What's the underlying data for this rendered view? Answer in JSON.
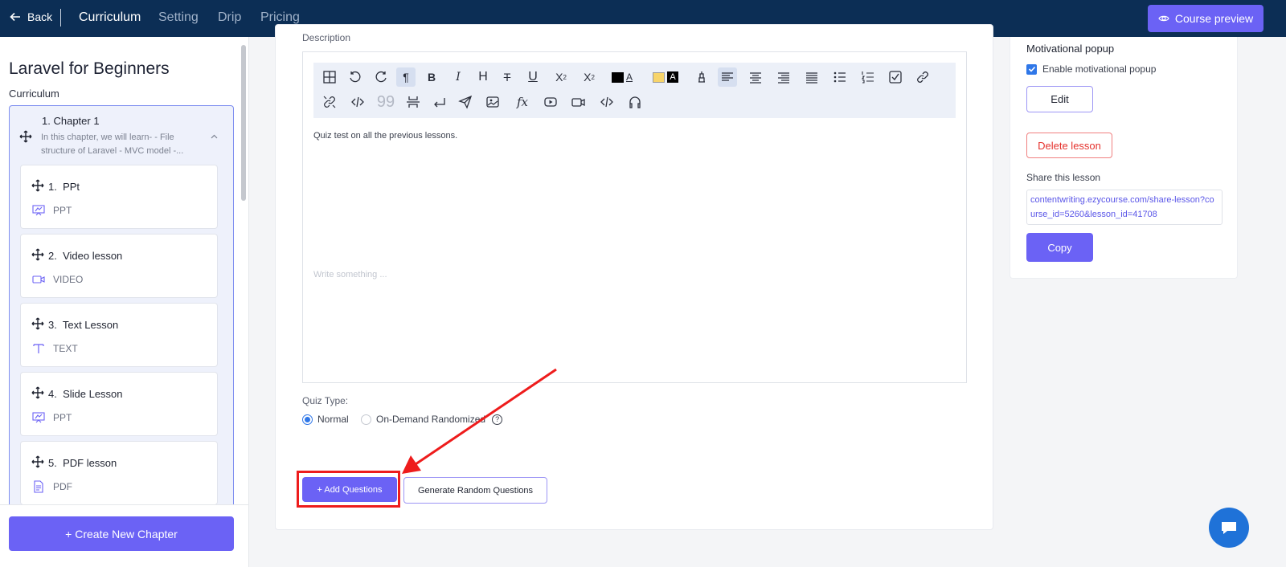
{
  "topbar": {
    "back_label": "Back",
    "tabs": [
      {
        "label": "Curriculum",
        "active": true
      },
      {
        "label": "Setting",
        "active": false
      },
      {
        "label": "Drip",
        "active": false
      },
      {
        "label": "Pricing",
        "active": false
      }
    ],
    "preview_label": "Course preview"
  },
  "sidebar": {
    "course_title": "Laravel for Beginners",
    "curriculum_label": "Curriculum",
    "chapter": {
      "number": "1.",
      "title": "Chapter 1",
      "description": "In this chapter, we will learn- - File structure of Laravel - MVC model -..."
    },
    "lessons": [
      {
        "number": "1.",
        "title": "PPt",
        "type": "PPT",
        "icon": "presentation-icon"
      },
      {
        "number": "2.",
        "title": "Video lesson",
        "type": "VIDEO",
        "icon": "video-icon"
      },
      {
        "number": "3.",
        "title": "Text Lesson",
        "type": "TEXT",
        "icon": "text-icon"
      },
      {
        "number": "4.",
        "title": "Slide Lesson",
        "type": "PPT",
        "icon": "presentation-icon"
      },
      {
        "number": "5.",
        "title": "PDF lesson",
        "type": "PDF",
        "icon": "document-icon"
      }
    ],
    "create_chapter_label": "+ Create New Chapter"
  },
  "editor": {
    "description_label": "Description",
    "content": "Quiz test on all the previous lessons.",
    "placeholder": "Write something ..."
  },
  "quiz": {
    "type_label": "Quiz Type:",
    "options": [
      {
        "label": "Normal",
        "selected": true
      },
      {
        "label": "On-Demand Randomized",
        "selected": false
      }
    ],
    "help_glyph": "?",
    "add_questions_label": "+ Add Questions",
    "generate_random_label": "Generate Random Questions"
  },
  "right_panel": {
    "motivational_title": "Motivational popup",
    "enable_label": "Enable motivational popup",
    "enable_checked": true,
    "edit_label": "Edit",
    "delete_label": "Delete lesson",
    "share_label": "Share this lesson",
    "share_url": "contentwriting.ezycourse.com/share-lesson?course_id=5260&lesson_id=41708",
    "copy_label": "Copy"
  },
  "colors": {
    "topbar": "#0c2e55",
    "accent": "#6b62f5",
    "annotation": "#ee1c1c",
    "danger": "#e5322d",
    "chat": "#1f72d8"
  }
}
